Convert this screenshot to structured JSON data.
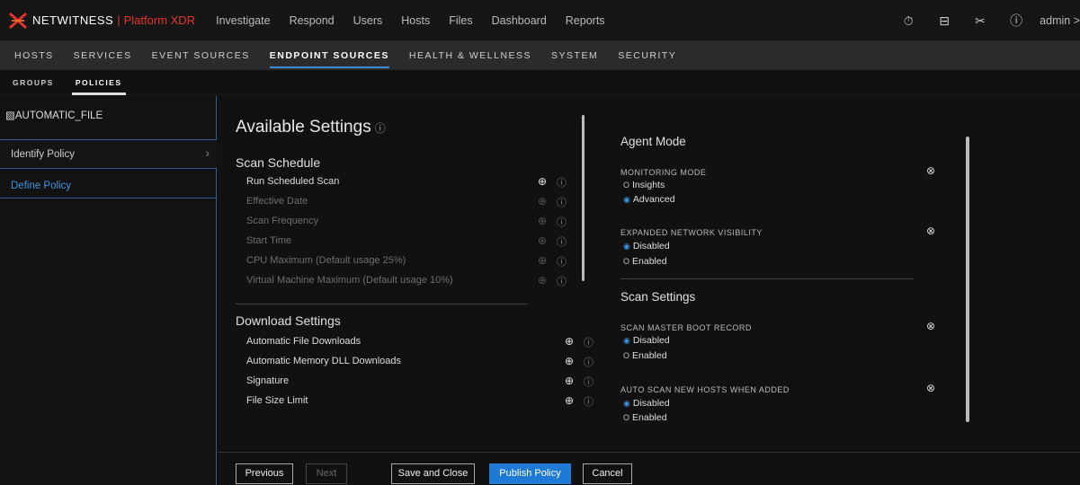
{
  "header": {
    "brand": "NETWITNESS",
    "product": "Platform XDR",
    "nav": [
      "Investigate",
      "Respond",
      "Users",
      "Hosts",
      "Files",
      "Dashboard",
      "Reports"
    ],
    "user": "admin >"
  },
  "subnav": {
    "items": [
      "HOSTS",
      "SERVICES",
      "EVENT SOURCES",
      "ENDPOINT SOURCES",
      "HEALTH & WELLNESS",
      "SYSTEM",
      "SECURITY"
    ],
    "active": "ENDPOINT SOURCES"
  },
  "tabs": {
    "items": [
      "GROUPS",
      "POLICIES"
    ],
    "active": "POLICIES"
  },
  "sidebar": {
    "title": "▧AUTOMATIC_FILE",
    "items": [
      "Identify Policy",
      "Define Policy"
    ]
  },
  "available": {
    "title": "Available Settings",
    "scan_schedule": {
      "title": "Scan Schedule",
      "rows": [
        "Run Scheduled Scan",
        "Effective Date",
        "Scan Frequency",
        "Start Time",
        "CPU Maximum (Default usage 25%)",
        "Virtual Machine Maximum (Default usage 10%)"
      ]
    },
    "download": {
      "title": "Download Settings",
      "rows": [
        "Automatic File Downloads",
        "Automatic Memory DLL Downloads",
        "Signature",
        "File Size Limit"
      ]
    }
  },
  "selected": {
    "agent_mode": {
      "title": "Agent Mode",
      "monitoring_label": "MONITORING MODE",
      "monitoring_opts": [
        "Insights",
        "Advanced"
      ],
      "monitoring_selected": "Advanced",
      "expanded_label": "EXPANDED NETWORK VISIBILITY",
      "expanded_opts": [
        "Disabled",
        "Enabled"
      ],
      "expanded_selected": "Disabled"
    },
    "scan_settings": {
      "title": "Scan Settings",
      "mbr_label": "SCAN MASTER BOOT RECORD",
      "mbr_opts": [
        "Disabled",
        "Enabled"
      ],
      "mbr_selected": "Disabled",
      "auto_label": "AUTO SCAN NEW HOSTS WHEN ADDED",
      "auto_opts": [
        "Disabled",
        "Enabled"
      ],
      "auto_selected": "Disabled"
    }
  },
  "footer": {
    "previous": "Previous",
    "next": "Next",
    "save_close": "Save and Close",
    "publish": "Publish Policy",
    "cancel": "Cancel"
  },
  "icons": {
    "plus": "⊕",
    "info": "ⓘ",
    "remove": "⊗"
  }
}
